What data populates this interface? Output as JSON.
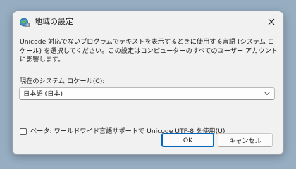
{
  "dialog": {
    "title": "地域の設定",
    "app_icon": "globe-settings-icon",
    "close_icon": "close-icon"
  },
  "content": {
    "description": "Unicode 対応でないプログラムでテキストを表示するときに使用する言語 (システム ロケール) を選択してください。この設定はコンピューターのすべてのユーザー アカウントに影響します。",
    "locale_label": "現在のシステム ロケール(C):",
    "locale_value": "日本語 (日本)",
    "utf8_label": "ベータ: ワールドワイド言語サポートで Unicode UTF-8 を使用(U)",
    "utf8_checked": false
  },
  "buttons": {
    "ok": "OK",
    "cancel": "キャンセル"
  },
  "colors": {
    "accent": "#0067c0",
    "dialog_bg": "#f1f1f1",
    "desktop_bg": "#97aec2"
  }
}
